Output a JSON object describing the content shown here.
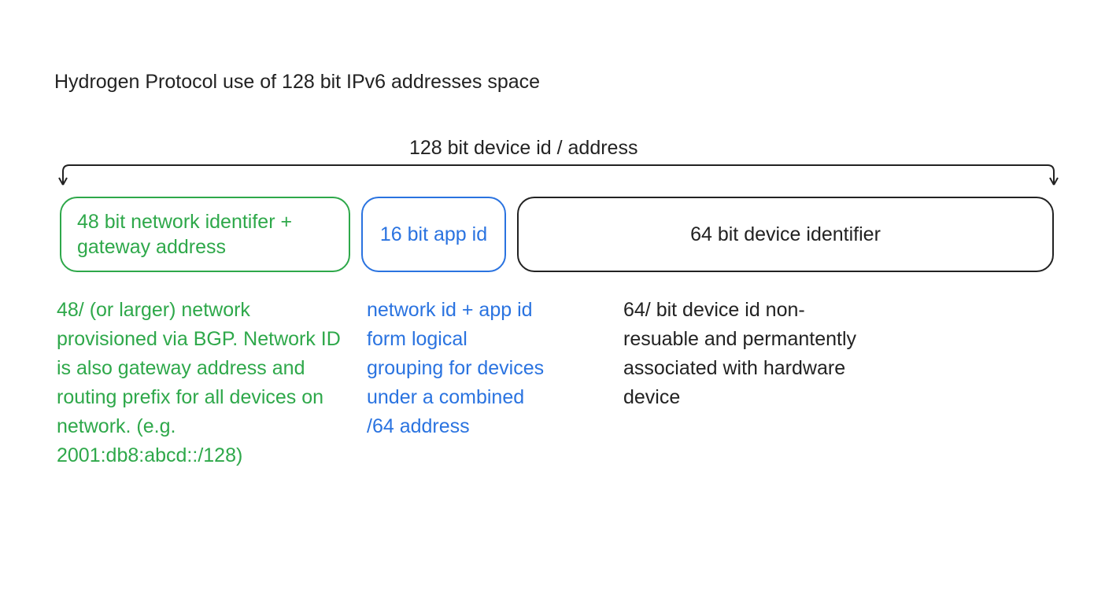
{
  "title": "Hydrogen Protocol use of 128 bit IPv6 addresses space",
  "bracket_label": "128 bit device id / address",
  "boxes": {
    "netid": "48 bit network identifer + gateway address",
    "appid": "16 bit app id",
    "devid": "64 bit device identifier"
  },
  "descriptions": {
    "netid": "48/ (or larger) network provisioned via BGP. Network ID is also gateway address and routing prefix for all devices on network. (e.g. 2001:db8:abcd::/128)",
    "appid": "network id + app id form logical grouping for devices under a combined /64 address",
    "devid": "64/ bit device id non-resuable and permantently associated with hardware device"
  },
  "colors": {
    "green": "#2ea84a",
    "blue": "#2a73e0",
    "black": "#222222"
  }
}
